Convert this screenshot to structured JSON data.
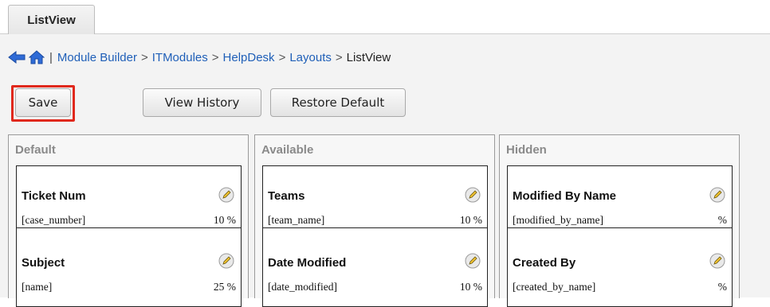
{
  "tab": {
    "label": "ListView"
  },
  "breadcrumb": {
    "links": [
      "Module Builder",
      "ITModules",
      "HelpDesk",
      "Layouts"
    ],
    "current": "ListView",
    "separator": ">",
    "bar": "|"
  },
  "toolbar": {
    "save_label": "Save",
    "view_history_label": "View History",
    "restore_default_label": "Restore Default"
  },
  "colors": {
    "highlight": "#e0281c",
    "link": "#1f5fb8",
    "panel_title": "#8a8a8a"
  },
  "panels": [
    {
      "title": "Default",
      "fields": [
        {
          "name": "Ticket Num",
          "key": "[case_number]",
          "width": "10 %"
        },
        {
          "name": "Subject",
          "key": "[name]",
          "width": "25 %"
        }
      ]
    },
    {
      "title": "Available",
      "fields": [
        {
          "name": "Teams",
          "key": "[team_name]",
          "width": "10 %"
        },
        {
          "name": "Date Modified",
          "key": "[date_modified]",
          "width": "10 %"
        }
      ]
    },
    {
      "title": "Hidden",
      "fields": [
        {
          "name": "Modified By Name",
          "key": "[modified_by_name]",
          "width": "%"
        },
        {
          "name": "Created By",
          "key": "[created_by_name]",
          "width": "%"
        }
      ]
    }
  ],
  "icons": {
    "back": "back-arrow-icon",
    "home": "home-icon",
    "edit": "pencil-edit-icon"
  }
}
